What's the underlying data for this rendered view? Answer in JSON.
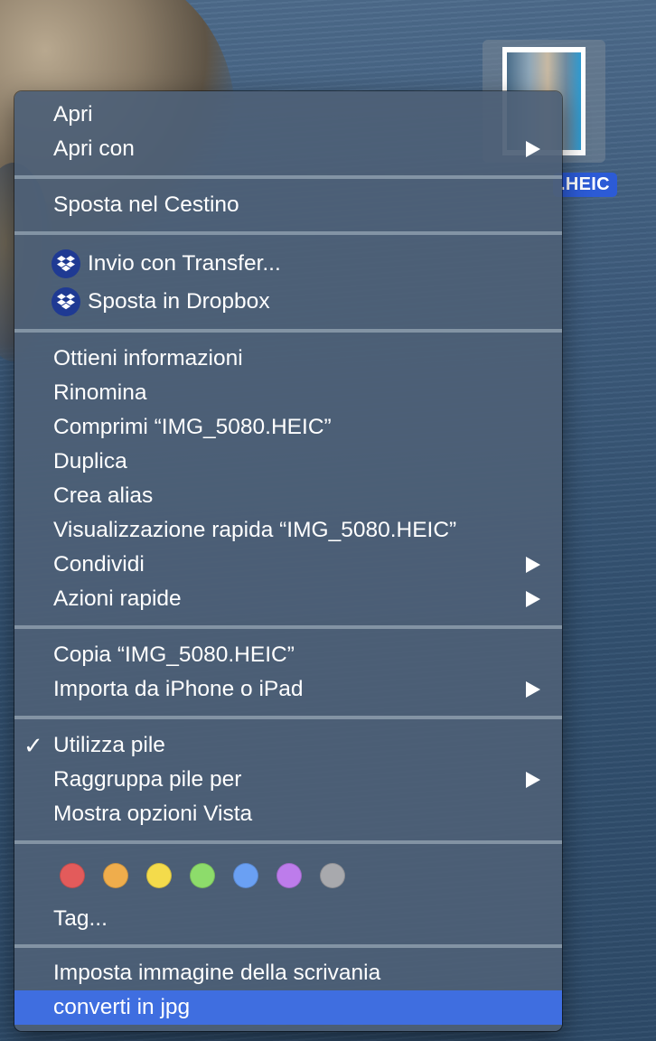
{
  "desktop": {
    "file_label": ".HEIC"
  },
  "menu": {
    "open": "Apri",
    "open_with": "Apri con",
    "move_to_trash": "Sposta nel Cestino",
    "send_transfer": "Invio con Transfer...",
    "move_dropbox": "Sposta in Dropbox",
    "get_info": "Ottieni informazioni",
    "rename": "Rinomina",
    "compress": "Comprimi “IMG_5080.HEIC”",
    "duplicate": "Duplica",
    "make_alias": "Crea alias",
    "quick_look": "Visualizzazione rapida “IMG_5080.HEIC”",
    "share": "Condividi",
    "quick_actions": "Azioni rapide",
    "copy": "Copia “IMG_5080.HEIC”",
    "import_iphone": "Importa da iPhone o iPad",
    "use_stacks": "Utilizza pile",
    "use_stacks_checked": "✓",
    "group_stacks_by": "Raggruppa pile per",
    "show_view_options": "Mostra opzioni Vista",
    "tags": "Tag...",
    "set_desktop_picture": "Imposta immagine della scrivania",
    "convert_jpg": "converti in jpg"
  },
  "tag_colors": [
    {
      "name": "red",
      "color": "#e35b5b"
    },
    {
      "name": "orange",
      "color": "#efad4c"
    },
    {
      "name": "yellow",
      "color": "#f4db4b"
    },
    {
      "name": "green",
      "color": "#8ddc6b"
    },
    {
      "name": "blue",
      "color": "#6aa0f3"
    },
    {
      "name": "purple",
      "color": "#bd7ceb"
    },
    {
      "name": "gray",
      "color": "#a8a9ad"
    }
  ],
  "colors": {
    "highlight": "#3f6ee0",
    "selection_label": "#2c5bd6",
    "dropbox_badge": "#1f3a93"
  }
}
